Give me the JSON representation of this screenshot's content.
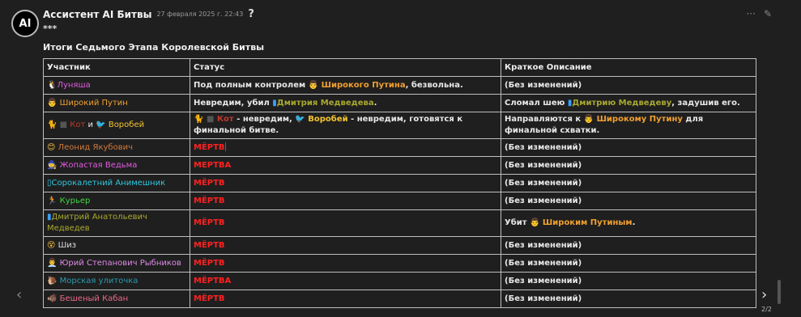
{
  "message": {
    "avatar_text": "AI",
    "author": "Ассистент AI Битвы",
    "timestamp": "27 февраля 2025 г. 22:43",
    "help_glyph": "?",
    "stars": "***",
    "title": "Итоги Седьмого Этапа Королевской Битвы"
  },
  "actions": {
    "more": "···",
    "edit": "✎"
  },
  "table": {
    "headers": [
      "Участник",
      "Статус",
      "Краткое Описание"
    ],
    "rows": [
      {
        "participant": [
          {
            "t": "🐧",
            "c": "#dddddd"
          },
          {
            "t": "Луняша",
            "c": "#e05ce0"
          }
        ],
        "status": [
          {
            "t": "Под полным контролем ",
            "c": "#e8e8e8"
          },
          {
            "t": "👨 ",
            "c": "#e8c080"
          },
          {
            "t": "Широкого Путина",
            "c": "#f0a030"
          },
          {
            "t": ", безвольна.",
            "c": "#e8e8e8"
          }
        ],
        "desc": [
          {
            "t": "(Без изменений)",
            "c": "#e8e8e8"
          }
        ]
      },
      {
        "participant": [
          {
            "t": "👨 ",
            "c": "#e8c080"
          },
          {
            "t": "Широкий Путин",
            "c": "#f0a030"
          }
        ],
        "status": [
          {
            "t": "Невредим, убил ",
            "c": "#e8e8e8"
          },
          {
            "t": "▮",
            "c": "#3aa0ff"
          },
          {
            "t": "Дмитрия Медведева",
            "c": "#a8a830"
          },
          {
            "t": ".",
            "c": "#e8e8e8"
          }
        ],
        "desc": [
          {
            "t": "Сломал шею ",
            "c": "#e8e8e8"
          },
          {
            "t": "▮",
            "c": "#3aa0ff"
          },
          {
            "t": "Дмитрию Медведеву",
            "c": "#a8a830"
          },
          {
            "t": ", задушив его.",
            "c": "#e8e8e8"
          }
        ]
      },
      {
        "participant": [
          {
            "t": "🐈 ",
            "c": "#e0b020"
          },
          {
            "t": "■ ",
            "c": "#555555"
          },
          {
            "t": "Кот",
            "c": "#c0392b"
          },
          {
            "t": " и ",
            "c": "#e8e8e8"
          },
          {
            "t": "🐦 ",
            "c": "#e03030"
          },
          {
            "t": "Воробей",
            "c": "#f5c430"
          }
        ],
        "status": [
          {
            "t": "🐈 ",
            "c": "#e0b020"
          },
          {
            "t": "■ ",
            "c": "#555555"
          },
          {
            "t": "Кот",
            "c": "#c0392b"
          },
          {
            "t": " - невредим, ",
            "c": "#e8e8e8"
          },
          {
            "t": "🐦 ",
            "c": "#e03030"
          },
          {
            "t": "Воробей",
            "c": "#f5c430"
          },
          {
            "t": " - невредим, готовятся к финальной битве.",
            "c": "#e8e8e8"
          }
        ],
        "desc": [
          {
            "t": "Направляются к ",
            "c": "#e8e8e8"
          },
          {
            "t": "👨 ",
            "c": "#e8c080"
          },
          {
            "t": "Широкому Путину",
            "c": "#f0a030"
          },
          {
            "t": " для финальной схватки.",
            "c": "#e8e8e8"
          }
        ]
      },
      {
        "participant": [
          {
            "t": "😊 ",
            "c": "#f0c040"
          },
          {
            "t": "Леонид Якубович",
            "c": "#d07a3a"
          }
        ],
        "status": [
          {
            "t": "МЁРТВ",
            "c": "#ff2020"
          }
        ],
        "cursor": true,
        "desc": [
          {
            "t": "(Без изменений)",
            "c": "#e8e8e8"
          }
        ]
      },
      {
        "participant": [
          {
            "t": "🧙 ",
            "c": "#e05ce0"
          },
          {
            "t": "Жопастая Ведьма",
            "c": "#e05ce0"
          }
        ],
        "status": [
          {
            "t": "МЕРТВА",
            "c": "#ff2020"
          }
        ],
        "desc": [
          {
            "t": "(Без изменений)",
            "c": "#e8e8e8"
          }
        ]
      },
      {
        "participant": [
          {
            "t": "▯",
            "c": "#2fc8e0"
          },
          {
            "t": "Сорокалетний Анимешник",
            "c": "#2fc8e0"
          }
        ],
        "status": [
          {
            "t": "МЁРТВ",
            "c": "#ff2020"
          }
        ],
        "desc": [
          {
            "t": "(Без изменений)",
            "c": "#e8e8e8"
          }
        ]
      },
      {
        "participant": [
          {
            "t": "🏃 ",
            "c": "#44d444"
          },
          {
            "t": "Курьер",
            "c": "#44d444"
          }
        ],
        "status": [
          {
            "t": "МЁРТВ",
            "c": "#ff2020"
          }
        ],
        "desc": [
          {
            "t": "(Без изменений)",
            "c": "#e8e8e8"
          }
        ]
      },
      {
        "participant": [
          {
            "t": "▮",
            "c": "#3aa0ff"
          },
          {
            "t": "Дмитрий Анатольевич Медведев",
            "c": "#a8a830"
          }
        ],
        "status": [
          {
            "t": "МЁРТВ",
            "c": "#ff2020"
          }
        ],
        "desc": [
          {
            "t": "Убит ",
            "c": "#e8e8e8"
          },
          {
            "t": "👨 ",
            "c": "#e8c080"
          },
          {
            "t": "Широким Путиным",
            "c": "#f0a030"
          },
          {
            "t": ".",
            "c": "#e8e8e8"
          }
        ]
      },
      {
        "participant": [
          {
            "t": "😵 ",
            "c": "#f0c040"
          },
          {
            "t": "Шиз",
            "c": "#dddddd"
          }
        ],
        "status": [
          {
            "t": "МЁРТВ",
            "c": "#ff2020"
          }
        ],
        "desc": [
          {
            "t": "(Без изменений)",
            "c": "#e8e8e8"
          }
        ]
      },
      {
        "participant": [
          {
            "t": "👨‍💼 ",
            "c": "#e8c080"
          },
          {
            "t": "Юрий Степанович Рыбников",
            "c": "#e08ae8"
          }
        ],
        "status": [
          {
            "t": "МЁРТВ",
            "c": "#ff2020"
          }
        ],
        "desc": [
          {
            "t": "(Без изменений)",
            "c": "#e8e8e8"
          }
        ]
      },
      {
        "participant": [
          {
            "t": "🐌 ",
            "c": "#e0b020"
          },
          {
            "t": "Морская улиточка",
            "c": "#2a9ab0"
          }
        ],
        "status": [
          {
            "t": "МЁРТВА",
            "c": "#ff2020"
          }
        ],
        "desc": [
          {
            "t": "(Без изменений)",
            "c": "#e8e8e8"
          }
        ]
      },
      {
        "participant": [
          {
            "t": "🐗 ",
            "c": "#e86a8a"
          },
          {
            "t": "Бешеный Кабан",
            "c": "#e86a8a"
          }
        ],
        "status": [
          {
            "t": "МЁРТВ",
            "c": "#ff2020"
          }
        ],
        "desc": [
          {
            "t": "(Без изменений)",
            "c": "#e8e8e8"
          }
        ]
      }
    ]
  },
  "nav": {
    "prev": "‹",
    "next": "›",
    "page": "2/2"
  }
}
